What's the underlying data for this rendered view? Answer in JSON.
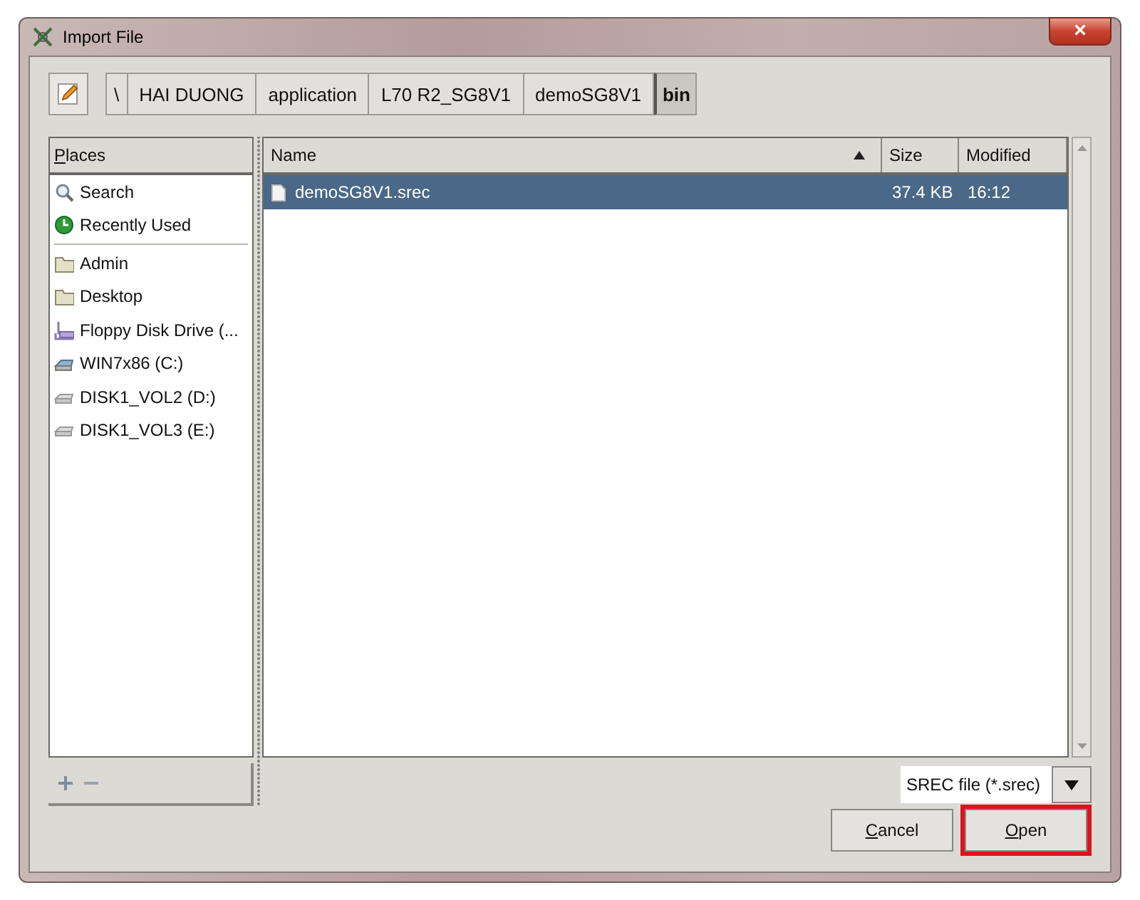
{
  "window": {
    "title": "Import File",
    "close_label": "×"
  },
  "path_bar": {
    "segments": [
      {
        "label": "\\",
        "selected": false
      },
      {
        "label": "HAI DUONG",
        "selected": false
      },
      {
        "label": "application",
        "selected": false
      },
      {
        "label": "L70 R2_SG8V1",
        "selected": false
      },
      {
        "label": "demoSG8V1",
        "selected": false
      },
      {
        "label": "bin",
        "selected": true
      }
    ]
  },
  "places": {
    "header": "Places",
    "groups": [
      [
        {
          "label": "Search",
          "kind": "search"
        },
        {
          "label": "Recently Used",
          "kind": "recent"
        }
      ],
      [
        {
          "label": "Admin",
          "kind": "folder"
        },
        {
          "label": "Desktop",
          "kind": "folder"
        },
        {
          "label": "Floppy Disk Drive (...",
          "kind": "floppy"
        },
        {
          "label": "WIN7x86 (C:)",
          "kind": "system-drive"
        },
        {
          "label": "DISK1_VOL2 (D:)",
          "kind": "drive"
        },
        {
          "label": "DISK1_VOL3 (E:)",
          "kind": "drive"
        }
      ]
    ]
  },
  "files": {
    "columns": [
      {
        "label": "Name",
        "sorted": true
      },
      {
        "label": "Size",
        "sorted": false
      },
      {
        "label": "Modified",
        "sorted": false
      }
    ],
    "rows": [
      {
        "name": "demoSG8V1.srec",
        "size": "37.4 KB",
        "modified": "16:12",
        "selected": true
      }
    ]
  },
  "filter": {
    "value": "SREC file (*.srec)"
  },
  "buttons": [
    {
      "label": "Cancel",
      "highlighted": false
    },
    {
      "label": "Open",
      "highlighted": true
    }
  ]
}
